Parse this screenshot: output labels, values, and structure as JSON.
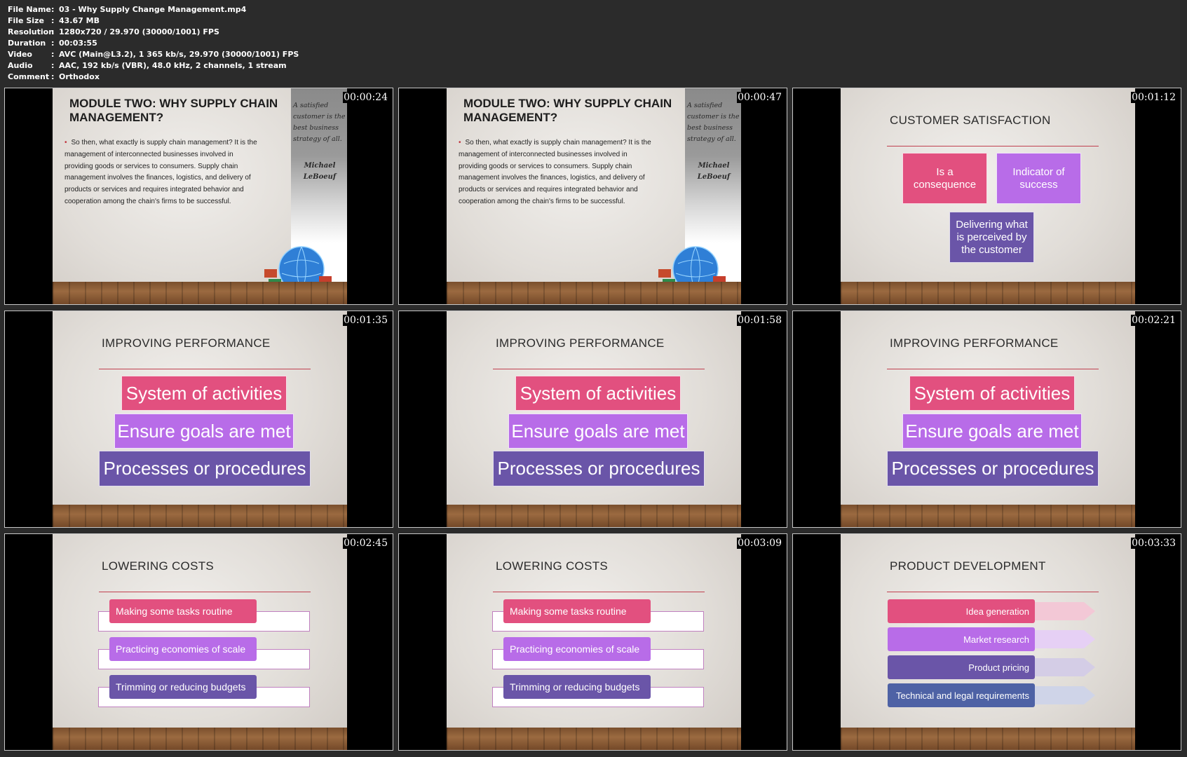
{
  "info": [
    {
      "key": "File Name",
      "value": "03 - Why Supply Change Management.mp4"
    },
    {
      "key": "File Size",
      "value": "43.67 MB"
    },
    {
      "key": "Resolution",
      "value": "1280x720 / 29.970 (30000/1001) FPS"
    },
    {
      "key": "Duration",
      "value": "00:03:55"
    },
    {
      "key": "Video",
      "value": "AVC (Main@L3.2), 1 365 kb/s, 29.970 (30000/1001) FPS"
    },
    {
      "key": "Audio",
      "value": "AAC, 192 kb/s (VBR), 48.0 kHz, 2 channels, 1 stream"
    },
    {
      "key": "Comment",
      "value": "Orthodox"
    }
  ],
  "separator": ":",
  "thumbs": {
    "t1": {
      "time": "00:00:24"
    },
    "t2": {
      "time": "00:00:47"
    },
    "t3": {
      "time": "00:01:12"
    },
    "t4": {
      "time": "00:01:35"
    },
    "t5": {
      "time": "00:01:58"
    },
    "t6": {
      "time": "00:02:21"
    },
    "t7": {
      "time": "00:02:45"
    },
    "t8": {
      "time": "00:03:09"
    },
    "t9": {
      "time": "00:03:33"
    }
  },
  "module": {
    "title": "MODULE TWO: WHY SUPPLY CHAIN MANAGEMENT?",
    "bullet": "•",
    "body": "So then, what exactly is supply chain management? It is the management of interconnected businesses involved in providing goods or services to consumers. Supply chain management involves the finances, logistics, and delivery of products or services and requires integrated behavior and cooperation among the chain's firms to be successful.",
    "quote": "A satisfied customer is the best business strategy of all.",
    "author": "Michael LeBoeuf"
  },
  "satisfaction": {
    "title": "CUSTOMER SATISFACTION",
    "box1": "Is a consequence",
    "box2": "Indicator of success",
    "box3": "Delivering what is perceived by the customer"
  },
  "performance": {
    "title": "IMPROVING PERFORMANCE",
    "level1": "System of activities",
    "level2": "Ensure goals are met",
    "level3": "Processes or procedures"
  },
  "costs": {
    "title": "LOWERING COSTS",
    "item1": "Making some tasks routine",
    "item2": "Practicing economies of scale",
    "item3": "Trimming or reducing budgets"
  },
  "development": {
    "title": "PRODUCT DEVELOPMENT",
    "step1": "Idea generation",
    "step2": "Market research",
    "step3": "Product pricing",
    "step4": "Technical and legal requirements"
  },
  "colors": {
    "pink": "#e2507f",
    "violet": "#b86ce8",
    "purple": "#6a55a8",
    "blue": "#4e62a5"
  }
}
